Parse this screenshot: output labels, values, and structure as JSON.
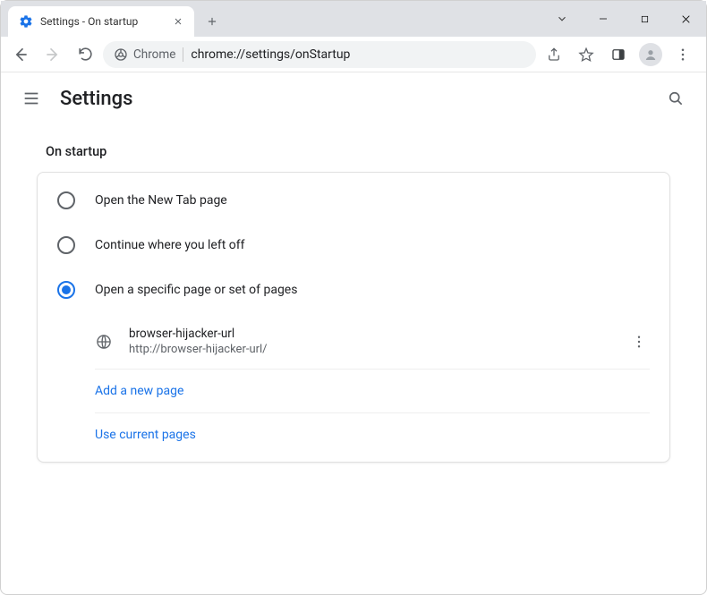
{
  "window": {
    "tab_title": "Settings - On startup"
  },
  "address_bar": {
    "scheme_label": "Chrome",
    "url": "chrome://settings/onStartup"
  },
  "settings": {
    "title": "Settings",
    "section_label": "On startup",
    "options": {
      "new_tab": "Open the New Tab page",
      "continue": "Continue where you left off",
      "specific": "Open a specific page or set of pages"
    },
    "startup_pages": [
      {
        "title": "browser-hijacker-url",
        "url": "http://browser-hijacker-url/"
      }
    ],
    "actions": {
      "add_page": "Add a new page",
      "use_current": "Use current pages"
    }
  },
  "colors": {
    "accent": "#1a73e8",
    "text_primary": "#202124",
    "text_secondary": "#5f6368",
    "chrome_grey": "#dfe1e5"
  }
}
